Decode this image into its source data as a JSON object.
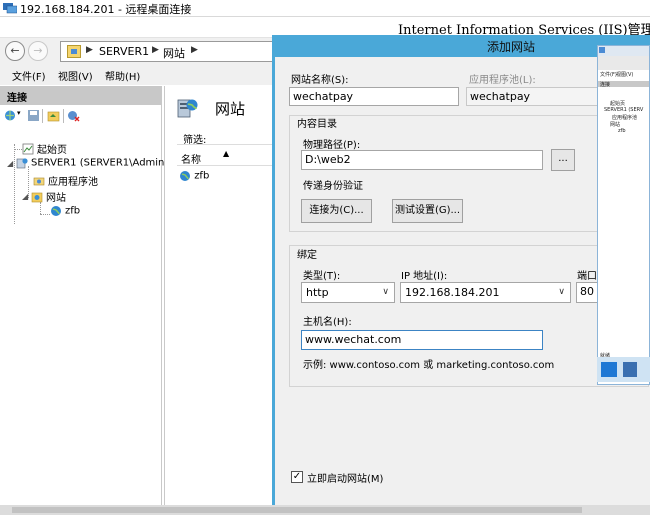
{
  "rdp": {
    "title": "192.168.184.201 - 远程桌面连接"
  },
  "iis": {
    "title": "Internet Information Services (IIS)管理器",
    "breadcrumb": [
      "SERVER1",
      "网站"
    ],
    "menu": [
      "文件(F)",
      "视图(V)",
      "帮助(H)"
    ]
  },
  "connections": {
    "header": "连接",
    "tree": {
      "start_page": "起始页",
      "server": "SERVER1 (SERVER1\\Admin",
      "app_pools": "应用程序池",
      "sites": "网站",
      "site_zfb": "zfb"
    }
  },
  "sites_view": {
    "title": "网站",
    "filter_label": "筛选:",
    "column_name": "名称",
    "rows": [
      "zfb"
    ]
  },
  "dialog": {
    "title": "添加网站",
    "site_name_label": "网站名称(S):",
    "site_name_value": "wechatpay",
    "app_pool_label": "应用程序池(L):",
    "app_pool_value": "wechatpay",
    "content_dir_label": "内容目录",
    "physical_path_label": "物理路径(P):",
    "physical_path_value": "D:\\web2",
    "browse_label": "...",
    "pass_auth_label": "传递身份验证",
    "connect_as_label": "连接为(C)...",
    "test_settings_label": "测试设置(G)...",
    "binding_label": "绑定",
    "type_label": "类型(T):",
    "type_value": "http",
    "ip_label": "IP 地址(I):",
    "ip_value": "192.168.184.201",
    "port_label": "端口(",
    "port_value": "80",
    "hostname_label": "主机名(H):",
    "hostname_value": "www.wechat.com",
    "example_text": "示例: www.contoso.com 或 marketing.contoso.com",
    "start_site_label": "立即启动网站(M)",
    "start_site_checked": true
  },
  "thumbnail": {
    "menu": [
      "文件(F)",
      "视图(V)"
    ],
    "conn": "连接",
    "tree": [
      "起始页",
      "SERVER1 (SERV",
      "应用程序池",
      "网站",
      "zfb"
    ],
    "footer": "就绪"
  },
  "colors": {
    "dialog_accent": "#4aa8d8",
    "panel_header": "#c8c8c8",
    "window_bg": "#f0f0f0"
  }
}
